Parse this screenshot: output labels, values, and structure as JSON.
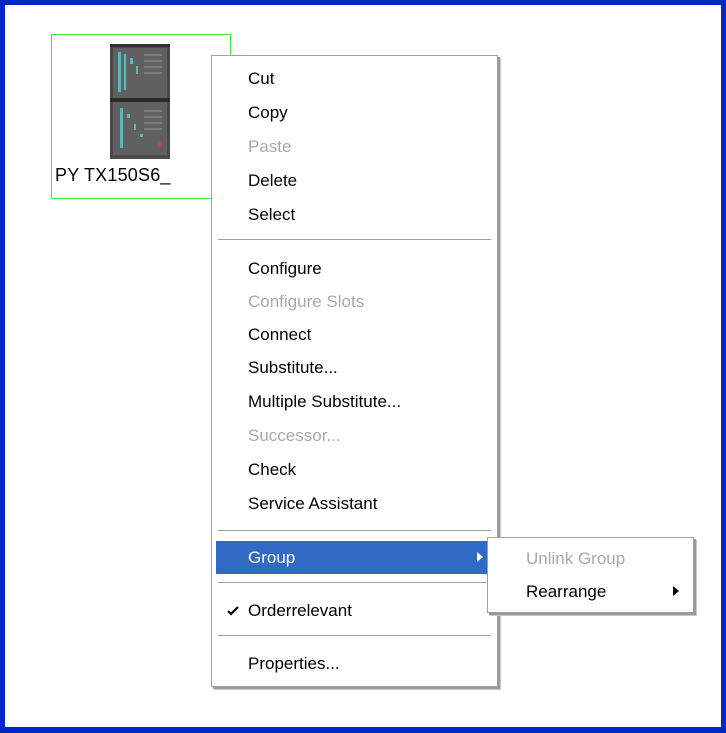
{
  "canvas": {
    "device": {
      "label": "PY TX150S6_",
      "icon": "server-tower-icon"
    }
  },
  "context_menu": {
    "items": [
      {
        "label": "Cut",
        "enabled": true
      },
      {
        "label": "Copy",
        "enabled": true
      },
      {
        "label": "Paste",
        "enabled": false
      },
      {
        "label": "Delete",
        "enabled": true
      },
      {
        "label": "Select",
        "enabled": true
      },
      {
        "label": "Configure",
        "enabled": true
      },
      {
        "label": "Configure Slots",
        "enabled": false
      },
      {
        "label": "Connect",
        "enabled": true
      },
      {
        "label": "Substitute...",
        "enabled": true
      },
      {
        "label": "Multiple Substitute...",
        "enabled": true
      },
      {
        "label": "Successor...",
        "enabled": false
      },
      {
        "label": "Check",
        "enabled": true
      },
      {
        "label": "Service Assistant",
        "enabled": true
      },
      {
        "label": "Group",
        "enabled": true,
        "highlighted": true,
        "has_submenu": true
      },
      {
        "label": "Orderrelevant",
        "enabled": true,
        "checked": true
      },
      {
        "label": "Properties...",
        "enabled": true
      }
    ]
  },
  "group_submenu": {
    "items": [
      {
        "label": "Unlink Group",
        "enabled": false
      },
      {
        "label": "Rearrange",
        "enabled": true,
        "has_submenu": true
      }
    ]
  },
  "colors": {
    "window_border": "#0028c8",
    "selection_border": "#33ee33",
    "highlight": "#316ac5",
    "disabled_text": "#a8a8a8"
  }
}
